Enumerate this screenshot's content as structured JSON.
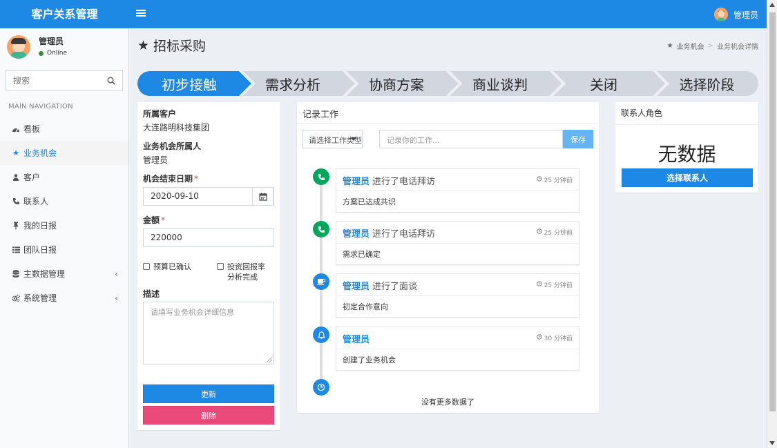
{
  "app": {
    "title": "客户关系管理",
    "user_name": "管理员"
  },
  "sidebar": {
    "user_name": "管理员",
    "user_status": "Online",
    "search_placeholder": "搜索",
    "nav_header": "MAIN NAVIGATION",
    "items": [
      {
        "label": "看板",
        "icon": "dashboard-icon"
      },
      {
        "label": "业务机会",
        "icon": "star-icon",
        "active": true
      },
      {
        "label": "客户",
        "icon": "users-icon"
      },
      {
        "label": "联系人",
        "icon": "phone-icon"
      },
      {
        "label": "我的日报",
        "icon": "pin-icon"
      },
      {
        "label": "团队日报",
        "icon": "list-icon"
      },
      {
        "label": "主数据管理",
        "icon": "database-icon",
        "has_children": true
      },
      {
        "label": "系统管理",
        "icon": "cogs-icon",
        "has_children": true
      }
    ]
  },
  "header": {
    "page_title": "招标采购",
    "breadcrumb": [
      "业务机会",
      "业务机会详情"
    ]
  },
  "stages": {
    "items": [
      "初步接触",
      "需求分析",
      "协商方案",
      "商业谈判",
      "关闭",
      "选择阶段"
    ],
    "active_index": 0,
    "active_color": "#1e88e5",
    "inactive_color": "#d2d6de"
  },
  "details": {
    "customer_label": "所属客户",
    "customer_value": "大连路明科技集团",
    "owner_label": "业务机会所属人",
    "owner_value": "管理员",
    "close_date_label": "机会结束日期",
    "close_date_required": "*",
    "close_date_value": "2020-09-10",
    "amount_label": "金额",
    "amount_required": "*",
    "amount_value": "220000",
    "budget_confirmed_label": "预算已确认",
    "roi_label_line1": "投资回报率",
    "roi_label_line2": "分析完成",
    "description_label": "描述",
    "description_placeholder": "请填写业务机会详细信息",
    "update_button": "更新",
    "delete_button": "删除"
  },
  "worklog": {
    "title": "记录工作",
    "type_placeholder": "请选择工作类型",
    "work_placeholder": "记录你的工作...",
    "save_button": "保存",
    "entries": [
      {
        "who": "管理员",
        "action": "进行了电话拜访",
        "time": "25 分钟前",
        "body": "方案已达成共识",
        "icon": "phone-icon",
        "color": "#00a65a"
      },
      {
        "who": "管理员",
        "action": "进行了电话拜访",
        "time": "25 分钟前",
        "body": "需求已确定",
        "icon": "phone-icon",
        "color": "#00a65a"
      },
      {
        "who": "管理员",
        "action": "进行了面谈",
        "time": "25 分钟前",
        "body": "初定合作意向",
        "icon": "coffee-icon",
        "color": "#1e88e5"
      },
      {
        "who": "管理员",
        "action": "",
        "time": "30 分钟前",
        "body": "创建了业务机会",
        "icon": "bell-icon",
        "color": "#1e88e5"
      }
    ],
    "end_icon_color": "#1e88e5",
    "no_more": "没有更多数据了"
  },
  "contacts": {
    "title": "联系人角色",
    "empty": "无数据",
    "select_button": "选择联系人"
  }
}
